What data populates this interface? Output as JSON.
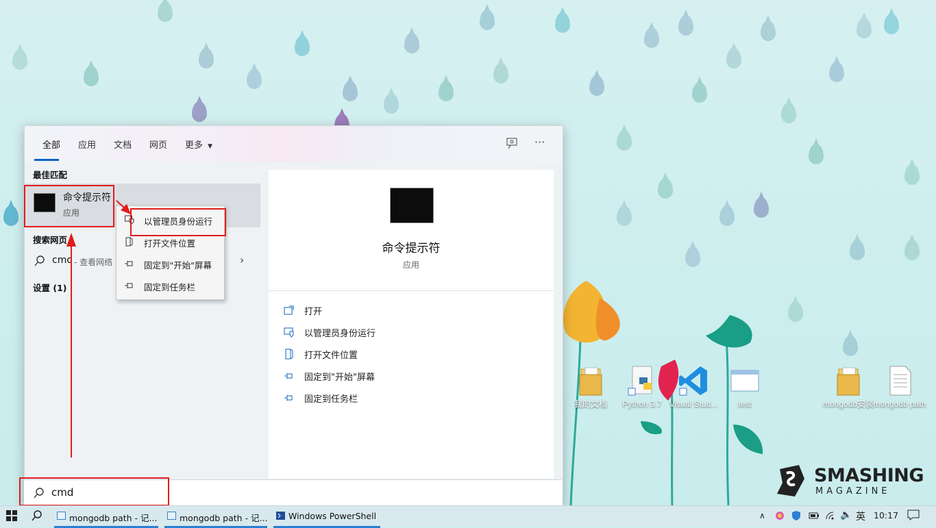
{
  "tabs": [
    "全部",
    "应用",
    "文档",
    "网页",
    "更多"
  ],
  "header_icons": [
    "feedback-icon",
    "more-options-icon"
  ],
  "best_match": {
    "section_title": "最佳匹配",
    "name": "命令提示符",
    "type": "应用"
  },
  "web_search": {
    "section_title": "搜索网页",
    "query": "cmd",
    "suffix": " - 查看网络"
  },
  "settings_section": "设置 (1)",
  "context_menu": [
    "以管理员身份运行",
    "打开文件位置",
    "固定到\"开始\"屏幕",
    "固定到任务栏"
  ],
  "detail": {
    "name": "命令提示符",
    "type": "应用",
    "actions": [
      "打开",
      "以管理员身份运行",
      "打开文件位置",
      "固定到\"开始\"屏幕",
      "固定到任务栏"
    ]
  },
  "search_input": "cmd",
  "desktop_icons": [
    "我的文档",
    "Python 3.7",
    "Visual Stud...",
    "test",
    "mongodb安装",
    "mongodb path"
  ],
  "taskbar": {
    "apps": [
      "mongodb path - 记...",
      "mongodb path - 记...",
      "Windows PowerShell"
    ],
    "ime": "英",
    "time": "10:17"
  },
  "watermark": {
    "line1": "SMASHING",
    "line2": "MAGAZINE"
  },
  "colors": {
    "accent": "#0a62c2",
    "highlight": "#e21b1b",
    "taskbar_accent": "#2a7fd4"
  }
}
